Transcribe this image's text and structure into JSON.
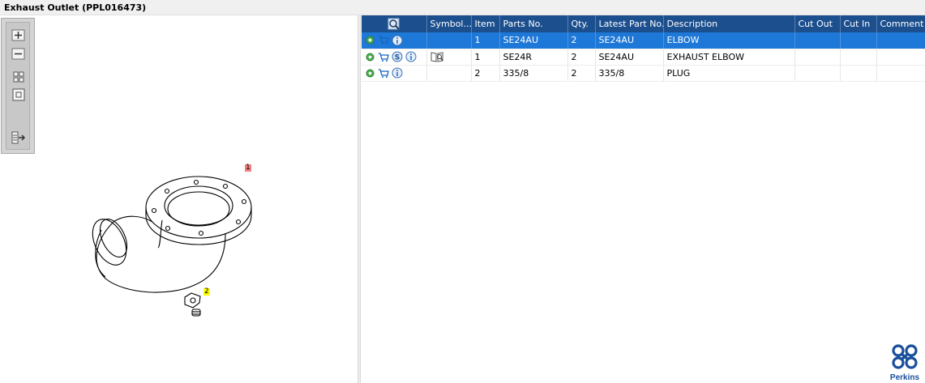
{
  "window": {
    "title": "Exhaust Outlet (PPL016473)"
  },
  "toolbar": {
    "buttons": [
      "zoom-in",
      "zoom-out",
      "fit-all",
      "fit-window",
      "toggle-list"
    ]
  },
  "drawing": {
    "callouts": [
      "1",
      "2"
    ]
  },
  "table": {
    "columns": [
      "",
      "Symbol...",
      "Item",
      "Parts No.",
      "Qty.",
      "Latest Part No.",
      "Description",
      "Cut Out",
      "Cut In",
      "Comment"
    ],
    "rows": [
      {
        "item": "1",
        "parts_no": "SE24AU",
        "qty": "2",
        "latest_part_no": "SE24AU",
        "description": "ELBOW",
        "cut_out": "",
        "cut_in": "",
        "comment": "",
        "selected": true
      },
      {
        "item": "1",
        "parts_no": "SE24R",
        "qty": "2",
        "latest_part_no": "SE24AU",
        "description": "EXHAUST ELBOW",
        "cut_out": "",
        "cut_in": "",
        "comment": "",
        "selected": false
      },
      {
        "item": "2",
        "parts_no": "335/8",
        "qty": "2",
        "latest_part_no": "335/8",
        "description": "PLUG",
        "cut_out": "",
        "cut_in": "",
        "comment": "",
        "selected": false
      }
    ]
  },
  "brand": {
    "name": "Perkins"
  },
  "colors": {
    "header": "#1c4f8e",
    "selected": "#1e78d7",
    "brand": "#1a4f9c",
    "callout_1": "#f08080",
    "callout_2": "#ffff00"
  }
}
